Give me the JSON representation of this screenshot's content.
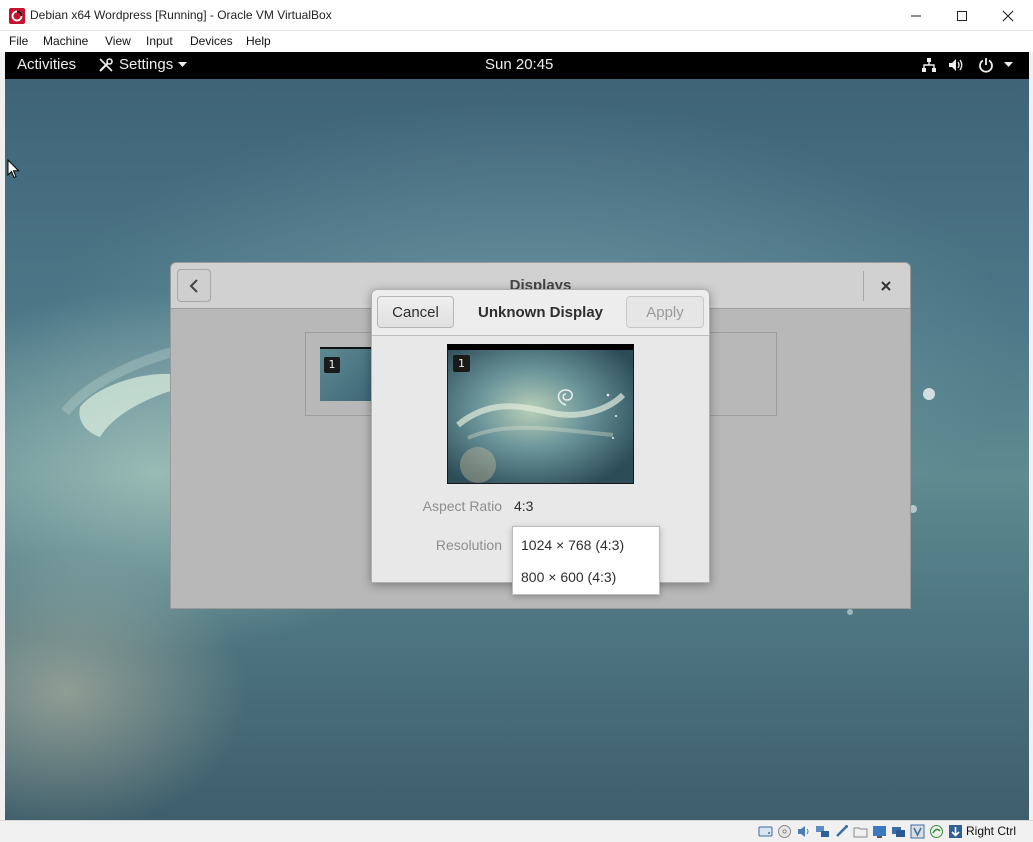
{
  "window": {
    "title": "Debian x64 Wordpress [Running] - Oracle VM VirtualBox"
  },
  "menubar": {
    "items": [
      "File",
      "Machine",
      "View",
      "Input",
      "Devices",
      "Help"
    ]
  },
  "gnome_topbar": {
    "activities": "Activities",
    "app_menu": "Settings",
    "clock": "Sun 20:45"
  },
  "displays_window": {
    "title": "Displays",
    "display_number": "1"
  },
  "dialog": {
    "cancel_label": "Cancel",
    "title": "Unknown Display",
    "apply_label": "Apply",
    "display_number": "1",
    "aspect_ratio_label": "Aspect Ratio",
    "aspect_ratio_value": "4:3",
    "resolution_label": "Resolution",
    "resolution_options": [
      "1024 × 768 (4:3)",
      "800 × 600 (4:3)"
    ]
  },
  "statusbar": {
    "host_key": "Right Ctrl",
    "icons": [
      "hard-disk-icon",
      "optical-drive-icon",
      "audio-icon",
      "network-icon",
      "usb-icon",
      "shared-folders-icon",
      "display-icon",
      "video-capture-icon",
      "recording-icon",
      "cpu-icon",
      "vt-icon",
      "mouse-integration-icon"
    ]
  },
  "colors": {
    "gnome_topbar": "#000000",
    "dialog_bg": "#e8e8e8",
    "brand_red": "#c4122f"
  }
}
